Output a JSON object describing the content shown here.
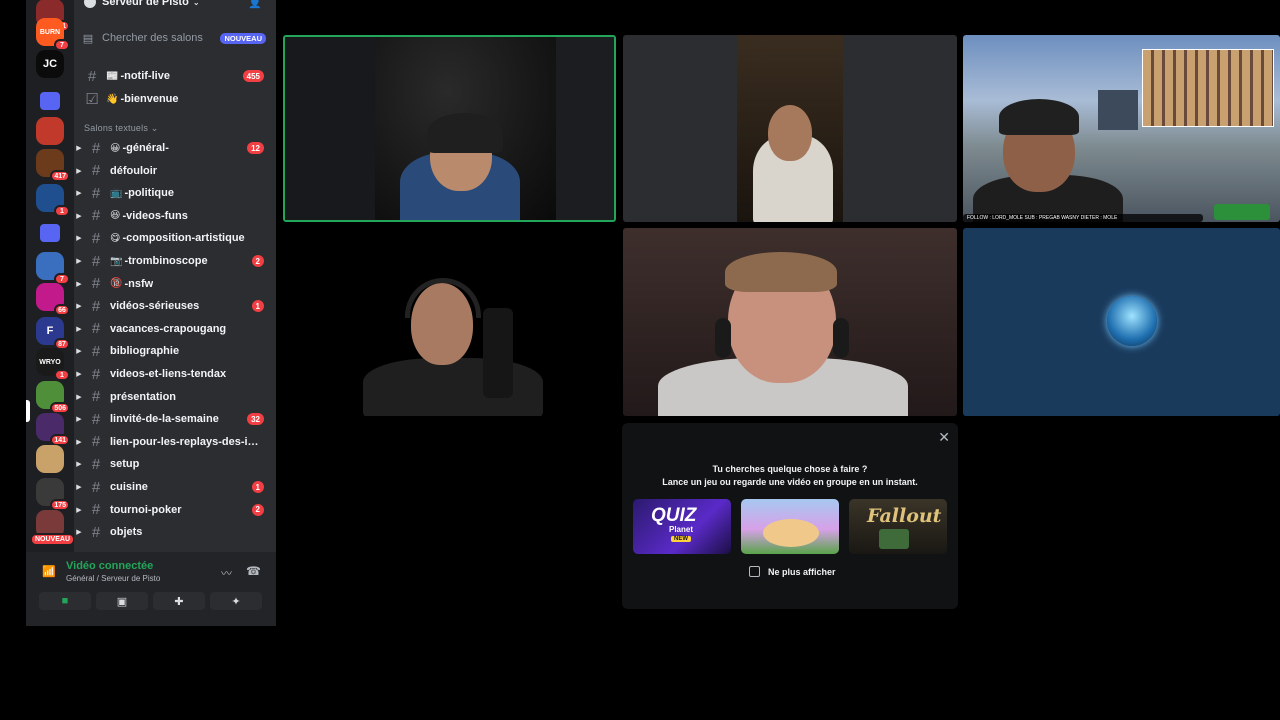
{
  "server": {
    "name": "Serveur de Pisto",
    "search_placeholder": "Chercher des salons",
    "search_tag": "NOUVEAU"
  },
  "rail": {
    "items": [
      {
        "label": "",
        "badge": "571",
        "color": "#8a2a2a"
      },
      {
        "label": "BURN",
        "badge": "7",
        "color": "#ff5a1f"
      },
      {
        "label": "JC",
        "badge": "",
        "color": "#0b0b0b"
      },
      {
        "label": "",
        "badge": "",
        "color": "#5865f2"
      },
      {
        "label": "",
        "badge": "",
        "color": "#c0392b"
      },
      {
        "label": "",
        "badge": "417",
        "color": "#6b3b1b"
      },
      {
        "label": "",
        "badge": "1",
        "color": "#1f4f8f"
      },
      {
        "label": "",
        "badge": "",
        "color": "#5865f2"
      },
      {
        "label": "",
        "badge": "7",
        "color": "#3a6fbf"
      },
      {
        "label": "",
        "badge": "66",
        "color": "#c21a8a"
      },
      {
        "label": "F",
        "badge": "87",
        "color": "#2b3a8f"
      },
      {
        "label": "WRYO",
        "badge": "1",
        "color": "#1a1a1a"
      },
      {
        "label": "",
        "badge": "506",
        "color": "#4f8f3a"
      },
      {
        "label": "",
        "badge": "141",
        "color": "#4b2a6a"
      },
      {
        "label": "",
        "badge": "",
        "color": "#c9a26a"
      },
      {
        "label": "",
        "badge": "175",
        "color": "#3a3a3a"
      },
      {
        "label": "",
        "badge": "",
        "color": "#7a3a3a"
      }
    ],
    "new_tag": "NOUVEAU"
  },
  "channels": {
    "top": [
      {
        "icon": "#",
        "emoji": "📰",
        "name": "-notif-live",
        "count": "455"
      },
      {
        "icon": "☑",
        "emoji": "👋",
        "name": "-bienvenue",
        "count": ""
      }
    ],
    "category": "Salons textuels",
    "list": [
      {
        "emoji": "😀",
        "name": "-général-",
        "count": "12"
      },
      {
        "emoji": "",
        "name": "défouloir",
        "count": ""
      },
      {
        "emoji": "📺",
        "name": "-politique",
        "count": ""
      },
      {
        "emoji": "😆",
        "name": "-videos-funs",
        "count": ""
      },
      {
        "emoji": "😋",
        "name": "-composition-artistique",
        "count": ""
      },
      {
        "emoji": "📷",
        "name": "-trombinoscope",
        "count": "2"
      },
      {
        "emoji": "🔞",
        "name": "-nsfw",
        "count": ""
      },
      {
        "emoji": "",
        "name": "vidéos-sérieuses",
        "count": "1"
      },
      {
        "emoji": "",
        "name": "vacances-crapougang",
        "count": ""
      },
      {
        "emoji": "",
        "name": "bibliographie",
        "count": ""
      },
      {
        "emoji": "",
        "name": "videos-et-liens-tendax",
        "count": ""
      },
      {
        "emoji": "",
        "name": "présentation",
        "count": ""
      },
      {
        "emoji": "",
        "name": "linvité-de-la-semaine",
        "count": "32"
      },
      {
        "emoji": "",
        "name": "lien-pour-les-replays-des-inter…",
        "count": ""
      },
      {
        "emoji": "",
        "name": "setup",
        "count": ""
      },
      {
        "emoji": "",
        "name": "cuisine",
        "count": "1"
      },
      {
        "emoji": "",
        "name": "tournoi-poker",
        "count": "2"
      },
      {
        "emoji": "",
        "name": "objets",
        "count": ""
      }
    ]
  },
  "voice": {
    "status": "Vidéo connectée",
    "location": "Général / Serveur de Pisto"
  },
  "activity": {
    "title": "Tu cherches quelque chose à faire ?",
    "subtitle": "Lance un jeu ou regarde une vidéo en groupe en un instant.",
    "games": [
      {
        "name": "QUIZ",
        "sub": "Planet",
        "tag": "NEW"
      },
      {
        "name": "",
        "sub": "",
        "tag": ""
      },
      {
        "name": "Fallout",
        "sub": "",
        "tag": ""
      }
    ],
    "dont_show": "Ne plus afficher"
  },
  "tiles": {
    "stream_caption": "FOLLOW : LORD_MOLE  SUB : PREGAB WASNY  DIETER : MOLE"
  }
}
